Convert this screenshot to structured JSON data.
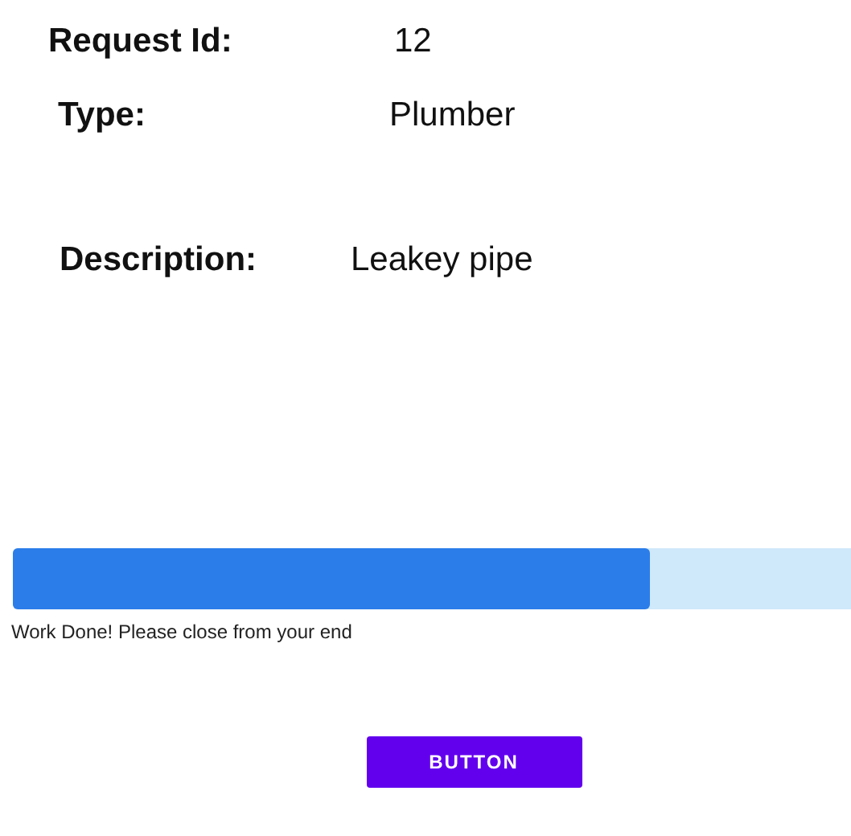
{
  "fields": [
    {
      "label": "Request Id:",
      "value": "12"
    },
    {
      "label": "Type:",
      "value": "Plumber"
    },
    {
      "label": "Description:",
      "value": "Leakey pipe"
    }
  ],
  "progress": {
    "level": 0.76,
    "message": "Work Done! Please close from your end"
  },
  "button": {
    "label": "BUTTON"
  }
}
